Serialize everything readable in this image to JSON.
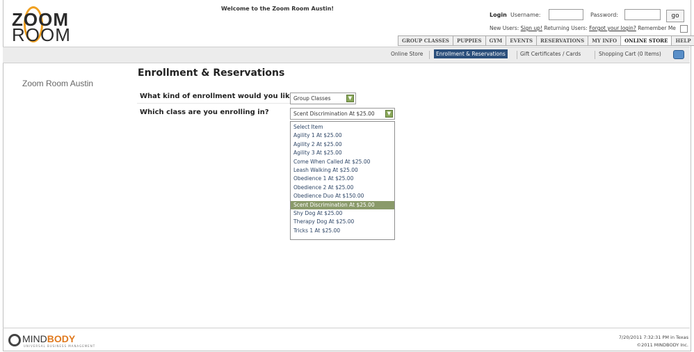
{
  "header": {
    "logo_top": "ZOOM",
    "logo_bottom": "ROOM",
    "welcome": "Welcome to the Zoom Room Austin!",
    "login_label": "Login",
    "username_label": "Username:",
    "password_label": "Password:",
    "go_label": "go",
    "new_users_text": "New Users:",
    "sign_up_link": "Sign up!",
    "returning_users_text": "Returning Users:",
    "forgot_link": "Forgot your login?",
    "remember_me": "Remember Me"
  },
  "tabs": [
    "GROUP CLASSES",
    "PUPPIES",
    "GYM",
    "EVENTS",
    "RESERVATIONS",
    "MY INFO",
    "ONLINE STORE",
    "HELP"
  ],
  "active_tab": "ONLINE STORE",
  "subnav": {
    "online_store": "Online Store",
    "enrollment": "Enrollment & Reservations",
    "gift": "Gift Certificates / Cards",
    "cart": "Shopping Cart (0 Items)"
  },
  "main": {
    "studio_name": "Zoom Room Austin",
    "title": "Enrollment & Reservations",
    "q1": "What kind of enrollment would you like?",
    "q1_value": "Group Classes",
    "q2": "Which class are you enrolling in?",
    "q2_value": "Scent Discrimination At $25.00",
    "options": [
      "Select Item",
      "Agility 1 At $25.00",
      "Agility 2 At $25.00",
      "Agility 3 At $25.00",
      "Come When Called At $25.00",
      "Leash Walking At $25.00",
      "Obedience 1 At $25.00",
      "Obedience 2 At $25.00",
      "Obedience Duo At $150.00",
      "Scent Discrimination At $25.00",
      "Shy Dog At $25.00",
      "Therapy Dog At $25.00",
      "Tricks 1 At $25.00"
    ],
    "selected_index": 9
  },
  "footer": {
    "brand_a": "MIND",
    "brand_b": "BODY",
    "brand_sub": "UNIVERSAL BUSINESS MANAGEMENT",
    "timestamp": "7/20/2011 7:32:31 PM in Texas",
    "copyright": "©2011 MINDBODY Inc."
  },
  "colors": {
    "accent_orange": "#f0a020",
    "active_blue": "#2b4f7b",
    "select_green": "#8a9a6a"
  }
}
